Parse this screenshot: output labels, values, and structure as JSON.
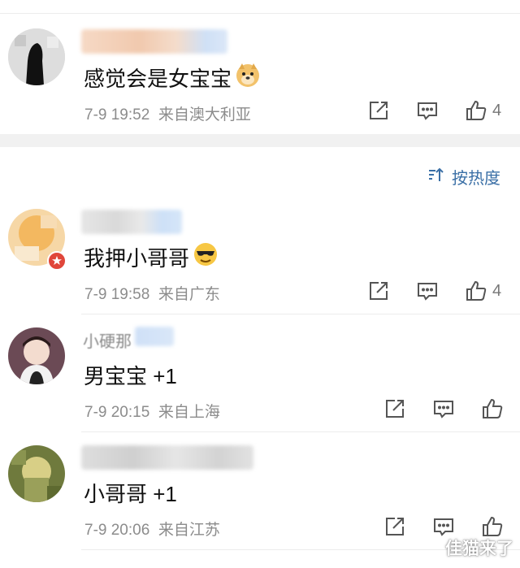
{
  "sort": {
    "label": "按热度"
  },
  "comments": [
    {
      "content": "感觉会是女宝宝",
      "emoji": "doge-emoji",
      "time": "7-9 19:52",
      "location": "来自澳大利亚",
      "likes": "4"
    },
    {
      "content": "我押小哥哥",
      "emoji": "sunglasses-emoji",
      "time": "7-9 19:58",
      "location": "来自广东",
      "likes": "4"
    },
    {
      "name_partial": "小硬那",
      "content": "男宝宝 +1",
      "time": "7-9 20:15",
      "location": "来自上海",
      "likes": ""
    },
    {
      "content": "小哥哥 +1",
      "time": "7-9 20:06",
      "location": "来自江苏",
      "likes": ""
    }
  ],
  "icons": {
    "share": "share-icon",
    "comment": "comment-icon",
    "like": "thumbs-up-icon",
    "sort": "sort-icon"
  },
  "colors": {
    "link": "#3a6fa6",
    "meta": "#8c8c8c",
    "separator": "#f1f1f1"
  },
  "watermark": {
    "text": "佳猫来了"
  }
}
